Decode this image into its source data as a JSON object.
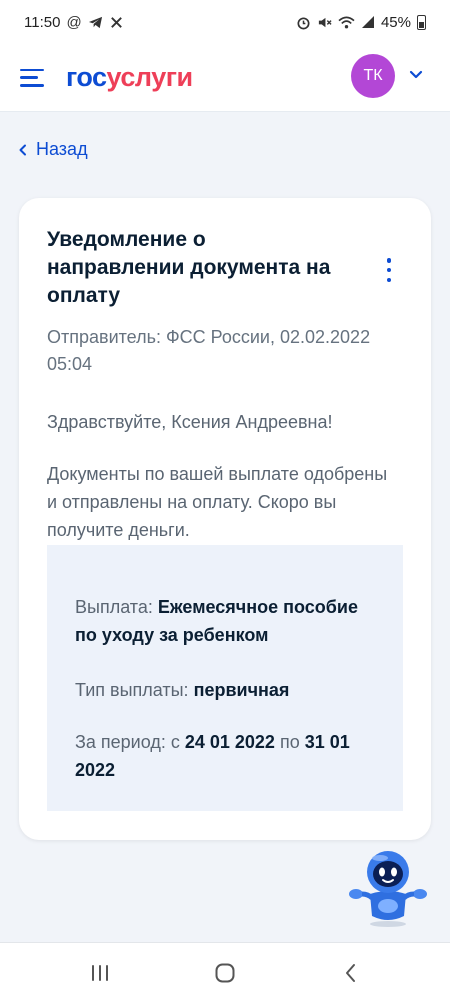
{
  "status_bar": {
    "time": "11:50",
    "battery": "45%",
    "left_icons": [
      "at-sign-icon",
      "telegram-icon",
      "no-missed-calls-icon"
    ],
    "right_icons": [
      "alarm-icon",
      "mute-icon",
      "wifi-icon",
      "signal-icon",
      "battery-icon"
    ]
  },
  "header": {
    "logo_part1": "гос",
    "logo_part2": "услуги",
    "avatar_initials": "ТК"
  },
  "nav": {
    "back_label": "Назад"
  },
  "notification": {
    "title": "Уведомление о направлении документа на оплату",
    "sender_line1": "Отправитель: ФСС России, 02.02.2022",
    "sender_line2": "05:04",
    "greeting": "Здравствуйте, Ксения Андреевна!",
    "message_line1": "Документы по вашей выплате одобрены",
    "message_line2": "и отправлены на оплату. Скоро вы",
    "message_line3": "получите деньги.",
    "details": {
      "payment_label": "Выплата:",
      "payment_value_line1": "Ежемесячное пособие",
      "payment_value_line2": "по уходу за ребенком",
      "type_label": "Тип выплаты:",
      "type_value": "первичная",
      "period_label": "За период: с",
      "period_from": "24 01 2022",
      "period_to_label": "по",
      "period_to": "31 01",
      "period_to_year": "2022"
    }
  },
  "colors": {
    "brand_blue": "#0d4cd3",
    "brand_red": "#ee3f58",
    "avatar": "#b347d6",
    "page_bg": "#f1f4f9",
    "details_bg": "#edf2fa"
  }
}
